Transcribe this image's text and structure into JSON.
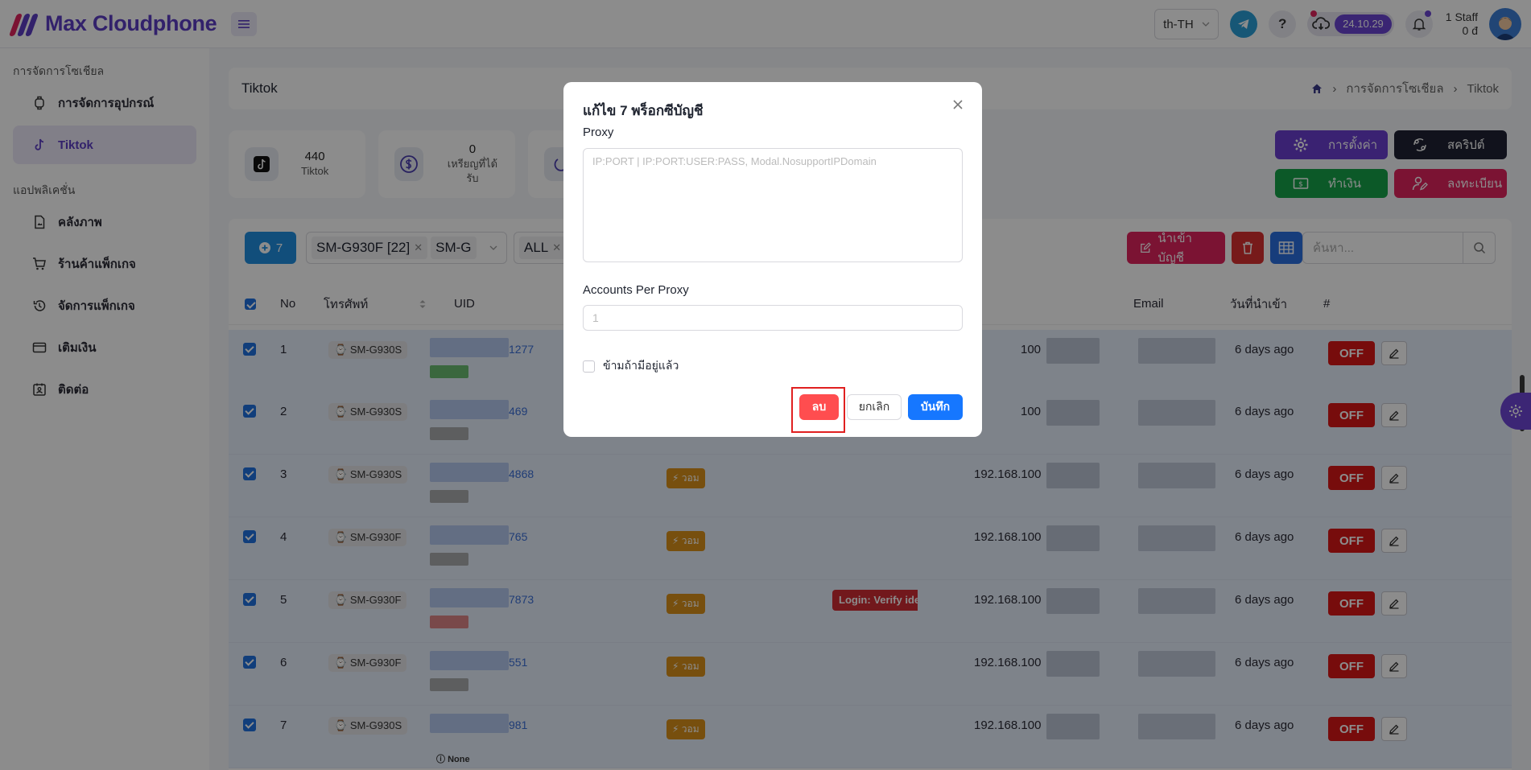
{
  "app": {
    "name": "Max Cloudphone",
    "language": "th-TH",
    "version": "24.10.29",
    "staff_label": "1 Staff",
    "staff_sub": "0 đ"
  },
  "sidebar": {
    "section1": "การจัดการโซเชียล",
    "items1": [
      {
        "label": "การจัดการอุปกรณ์",
        "icon": "device-icon"
      },
      {
        "label": "Tiktok",
        "icon": "tiktok-icon",
        "active": true
      }
    ],
    "section2": "แอปพลิเคชั่น",
    "items2": [
      {
        "label": "คลังภาพ",
        "icon": "image-file-icon"
      },
      {
        "label": "ร้านค้าแพ็กเกจ",
        "icon": "cart-icon"
      },
      {
        "label": "จัดการแพ็กเกจ",
        "icon": "history-icon"
      },
      {
        "label": "เติมเงิน",
        "icon": "wallet-icon"
      },
      {
        "label": "ติดต่อ",
        "icon": "contact-icon"
      }
    ]
  },
  "page": {
    "title": "Tiktok",
    "breadcrumb": [
      "การจัดการโซเชียล",
      "Tiktok"
    ]
  },
  "stats": [
    {
      "value": "440",
      "label": "Tiktok"
    },
    {
      "value": "0",
      "label": "เหรียญที่ได้รับ"
    }
  ],
  "actions": {
    "settings": "การตั้งค่า",
    "script": "สคริปต์",
    "earn": "ทำเงิน",
    "register": "ลงทะเบียน"
  },
  "toolbar": {
    "selected_count": "7",
    "device_tags": [
      "SM-G930F [22]",
      "SM-G"
    ],
    "filter_tag": "ALL",
    "import_label": "นำเข้าบัญชี",
    "search_placeholder": "ค้นหา..."
  },
  "table": {
    "headers": {
      "no": "No",
      "phone": "โทรศัพท์",
      "uid": "UID",
      "email": "Email",
      "imported": "วันที่นำเข้า",
      "hash": "#"
    },
    "rows": [
      {
        "no": "1",
        "device": "SM-G930S",
        "uid": "1277",
        "tag": "",
        "ip": "100",
        "date": "6 days ago",
        "status": "OFF"
      },
      {
        "no": "2",
        "device": "SM-G930S",
        "uid": "469",
        "tag": "",
        "ip": "100",
        "date": "6 days ago",
        "status": "OFF"
      },
      {
        "no": "3",
        "device": "SM-G930S",
        "uid": "4868",
        "tag": "วอม",
        "ip": "192.168.100",
        "date": "6 days ago",
        "status": "OFF"
      },
      {
        "no": "4",
        "device": "SM-G930F",
        "uid": "765",
        "tag": "วอม",
        "ip": "192.168.100",
        "date": "6 days ago",
        "status": "OFF"
      },
      {
        "no": "5",
        "device": "SM-G930F",
        "uid": "7873",
        "tag": "วอม",
        "ip": "192.168.100",
        "date": "6 days ago",
        "status": "OFF",
        "error": "Login: Verify identity"
      },
      {
        "no": "6",
        "device": "SM-G930F",
        "uid": "551",
        "tag": "วอม",
        "ip": "192.168.100",
        "date": "6 days ago",
        "status": "OFF"
      },
      {
        "no": "7",
        "device": "SM-G930S",
        "uid": "981",
        "tag": "วอม",
        "ip": "192.168.100",
        "date": "6 days ago",
        "status": "OFF",
        "note": "None"
      }
    ]
  },
  "modal": {
    "title": "แก้ไข 7 พร็อกซีบัญชี",
    "proxy_label": "Proxy",
    "proxy_placeholder": "IP:PORT | IP:PORT:USER:PASS, Modal.NosupportIPDomain",
    "per_proxy_label": "Accounts Per Proxy",
    "per_proxy_placeholder": "1",
    "skip_label": "ข้ามถ้ามีอยู่แล้ว",
    "delete_label": "ลบ",
    "cancel_label": "ยกเลิก",
    "save_label": "บันทึก"
  },
  "colors": {
    "brand": "#5b3cc4",
    "danger": "#ff4d4f",
    "primary": "#1677ff"
  }
}
